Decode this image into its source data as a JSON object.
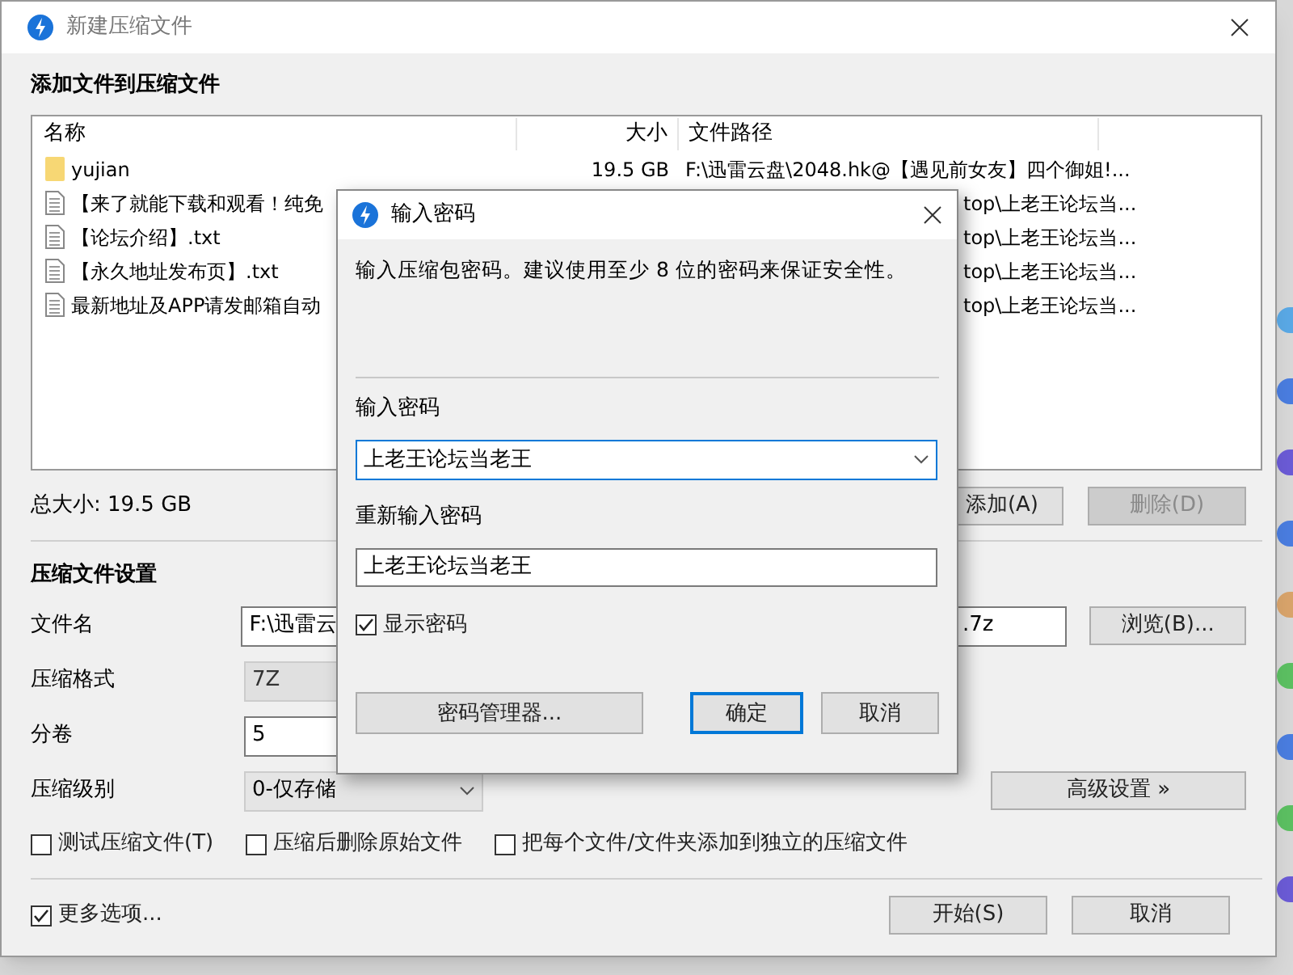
{
  "window": {
    "title": "新建压缩文件"
  },
  "files_section": {
    "heading": "添加文件到压缩文件",
    "columns": [
      "名称",
      "大小",
      "文件路径"
    ],
    "rows": [
      {
        "kind": "folder",
        "name": "yujian",
        "size": "19.5 GB",
        "path": "F:\\迅雷云盘\\2048.hk@【遇见前女友】四个御姐!..."
      },
      {
        "kind": "file",
        "name": "【来了就能下载和观看！纯免",
        "path": "top\\上老王论坛当..."
      },
      {
        "kind": "file",
        "name": "【论坛介绍】.txt",
        "path": "top\\上老王论坛当..."
      },
      {
        "kind": "file",
        "name": "【永久地址发布页】.txt",
        "path": "top\\上老王论坛当..."
      },
      {
        "kind": "file",
        "name": "最新地址及APP请发邮箱自动",
        "path": "top\\上老王论坛当..."
      }
    ],
    "total": "总大小: 19.5 GB",
    "buttons": [
      {
        "label": "添加(A)",
        "disabled": false
      },
      {
        "label": "删除(D)",
        "disabled": true
      }
    ]
  },
  "settings": {
    "heading": "压缩文件设置",
    "filename": {
      "label": "文件名",
      "value_start": "F:\\迅雷云",
      "value_end": ".7z",
      "button": "浏览(B)..."
    },
    "format": {
      "label": "压缩格式",
      "value": "7Z",
      "disabled": true
    },
    "split": {
      "label": "分卷",
      "value": "5"
    },
    "level": {
      "label": "压缩级别",
      "value": "0-仅存储",
      "button": "高级设置 »"
    },
    "options": [
      {
        "label": "测试压缩文件(T)",
        "checked": false
      },
      {
        "label": "压缩后删除原始文件",
        "checked": false
      },
      {
        "label": "把每个文件/文件夹添加到独立的压缩文件",
        "checked": false
      }
    ]
  },
  "footer": {
    "more": {
      "label": "更多选项...",
      "checked": true
    },
    "buttons": [
      "开始(S)",
      "取消"
    ]
  },
  "dialog": {
    "title": "输入密码",
    "description": "输入压缩包密码。建议使用至少 8 位的密码来保证安全性。",
    "password_label": "输入密码",
    "password": "上老王论坛当老王",
    "repeat_label": "重新输入密码",
    "repeat": "上老王论坛当老王",
    "show_password": {
      "label": "显示密码",
      "checked": true
    },
    "buttons": [
      {
        "label": "密码管理器...",
        "default": false
      },
      {
        "label": "确定",
        "default": true
      },
      {
        "label": "取消",
        "default": false
      }
    ]
  }
}
